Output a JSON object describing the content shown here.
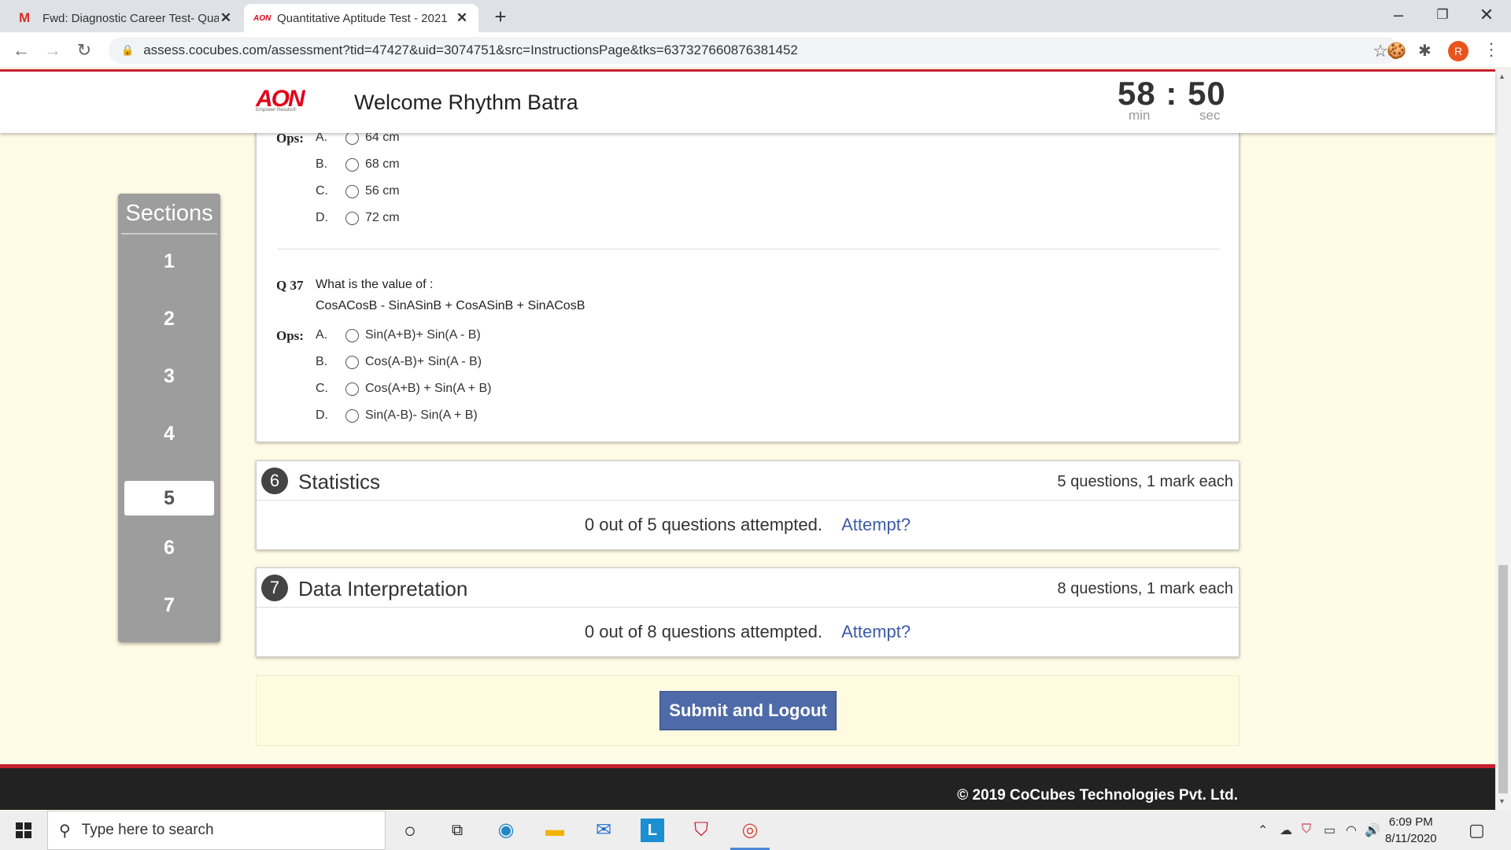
{
  "browser": {
    "tabs": [
      {
        "title": "Fwd: Diagnostic Career Test- Qua",
        "icon": "gmail-icon"
      },
      {
        "title": "Quantitative Aptitude Test - 2021",
        "icon": "aon-icon"
      }
    ],
    "url": "assess.cocubes.com/assessment?tid=47427&uid=3074751&src=InstructionsPage&tks=637327660876381452",
    "profile_initial": "R"
  },
  "header": {
    "logo_text": "AON",
    "logo_tagline": "Empower Results®",
    "welcome": "Welcome Rhythm Batra",
    "timer": {
      "minutes": "58",
      "separator": ":",
      "seconds": "50",
      "min_label": "min",
      "sec_label": "sec"
    }
  },
  "sections_panel": {
    "title": "Sections",
    "items": [
      "1",
      "2",
      "3",
      "4",
      "5",
      "6",
      "7"
    ],
    "active": "5"
  },
  "question_card": {
    "ops_label": "Ops:",
    "prev_options": [
      {
        "letter": "A.",
        "text": "64 cm"
      },
      {
        "letter": "B.",
        "text": "68 cm"
      },
      {
        "letter": "C.",
        "text": "56 cm"
      },
      {
        "letter": "D.",
        "text": "72 cm"
      }
    ],
    "question": {
      "number": "Q 37",
      "line1": "What is the value of :",
      "line2": "CosACosB - SinASinB + CosASinB + SinACosB",
      "options": [
        {
          "letter": "A.",
          "text": "Sin(A+B)+ Sin(A - B)"
        },
        {
          "letter": "B.",
          "text": "Cos(A-B)+ Sin(A - B)"
        },
        {
          "letter": "C.",
          "text": "Cos(A+B) + Sin(A + B)"
        },
        {
          "letter": "D.",
          "text": "Sin(A-B)- Sin(A + B)"
        }
      ]
    }
  },
  "section_cards": [
    {
      "number": "6",
      "title": "Statistics",
      "info": "5 questions, 1 mark each",
      "attempted": "0 out of 5 questions attempted.",
      "attempt_link": "Attempt?"
    },
    {
      "number": "7",
      "title": "Data Interpretation",
      "info": "8 questions, 1 mark each",
      "attempted": "0 out of 8 questions attempted.",
      "attempt_link": "Attempt?"
    }
  ],
  "submit_label": "Submit and Logout",
  "footer_text": "© 2019 CoCubes Technologies Pvt. Ltd.",
  "taskbar": {
    "search_placeholder": "Type here to search",
    "time": "6:09 PM",
    "date": "8/11/2020"
  }
}
